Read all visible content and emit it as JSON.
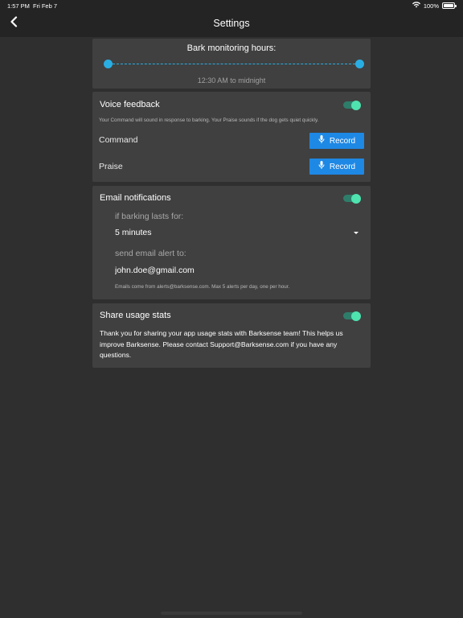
{
  "status_bar": {
    "time": "1:57 PM",
    "date": "Fri Feb 7",
    "battery": "100%",
    "wifi_icon": "wifi-icon",
    "battery_icon": "battery-icon"
  },
  "nav": {
    "title": "Settings",
    "back_icon": "chevron-left-icon"
  },
  "bark_hours": {
    "title": "Bark monitoring hours:",
    "range_text": "12:30 AM to midnight",
    "accent_color": "#29aee3"
  },
  "voice_feedback": {
    "title": "Voice feedback",
    "enabled": true,
    "note": "Your Command will sound in response to barking. Your Praise sounds if the dog gets quiet quickly.",
    "command_label": "Command",
    "praise_label": "Praise",
    "record_label": "Record",
    "record_icon": "microphone-icon",
    "button_color": "#1e88e5"
  },
  "email_notifications": {
    "title": "Email notifications",
    "enabled": true,
    "duration_label": "if barking lasts for:",
    "duration_value": "5 minutes",
    "email_label": "send email alert to:",
    "email_value": "john.doe@gmail.com",
    "note": "Emails come from alerts@barksense.com. Max 5 alerts per day, one per hour."
  },
  "share_stats": {
    "title": "Share usage stats",
    "enabled": true,
    "body": "Thank you for sharing your app usage stats with Barksense team! This helps us improve Barksense. Please contact Support@Barksense.com if you have any questions."
  },
  "toggle_color": "#4fe3b0"
}
